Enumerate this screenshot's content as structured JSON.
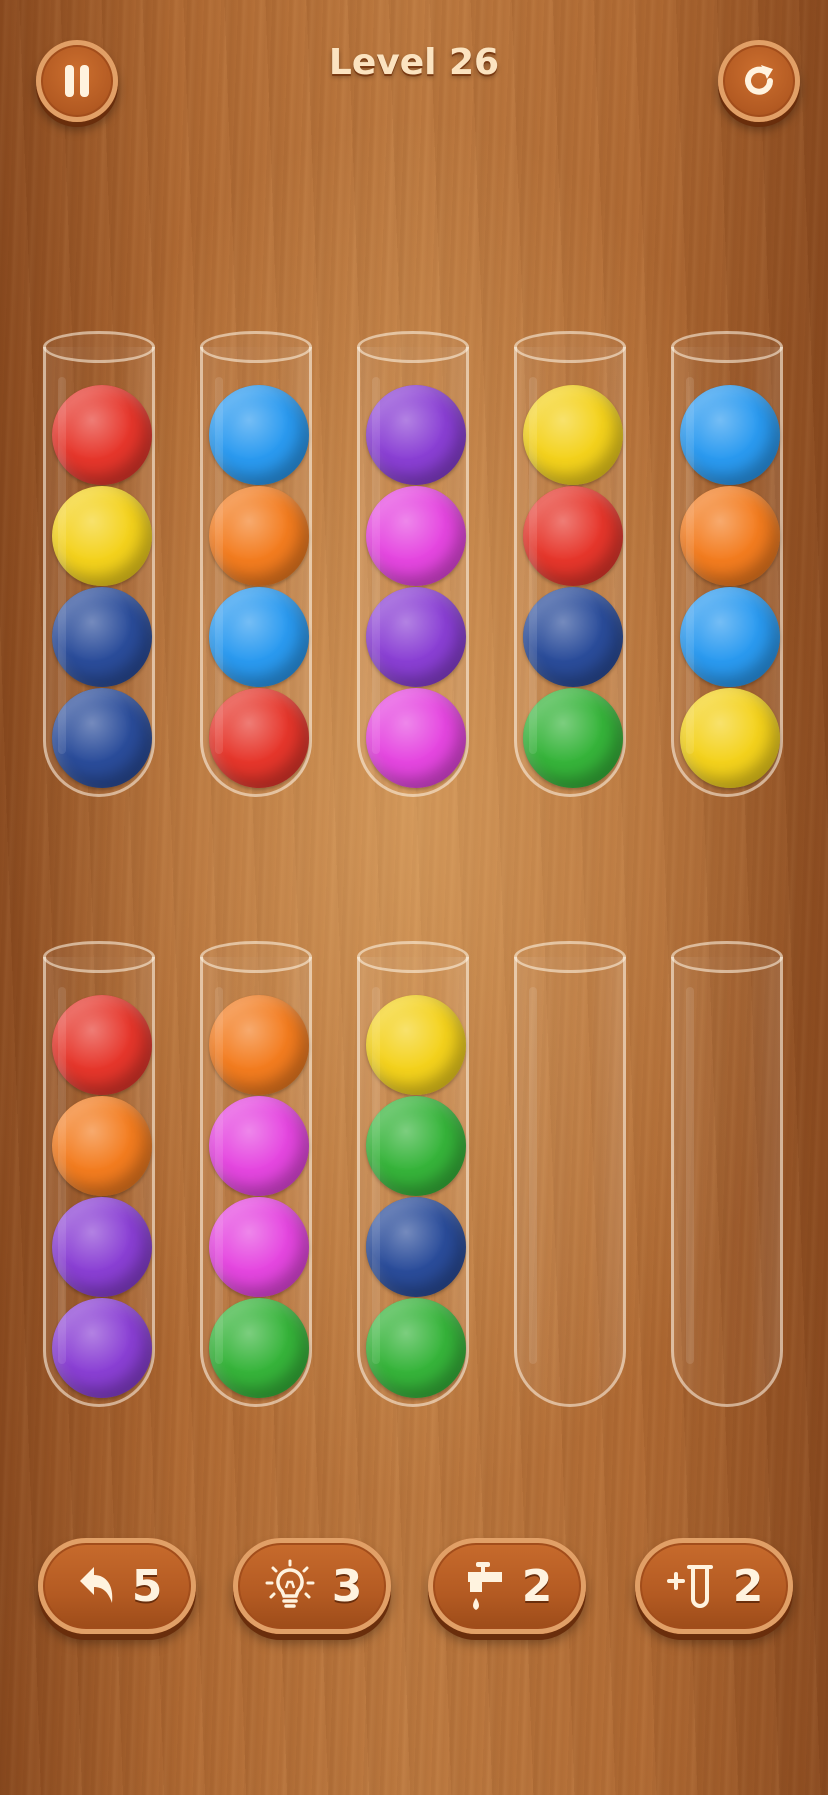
{
  "header": {
    "level_label": "Level 26",
    "pause_icon": "pause-icon",
    "restart_icon": "restart-icon"
  },
  "colors": {
    "red": "#e6362b",
    "yellow": "#f4d21c",
    "navy": "#2a4c9a",
    "blue": "#2a9af0",
    "orange": "#f37c1f",
    "purple": "#8a3fd4",
    "magenta": "#e546e0",
    "green": "#36b43a"
  },
  "tubes": [
    {
      "balls": [
        "red",
        "yellow",
        "navy",
        "navy"
      ]
    },
    {
      "balls": [
        "blue",
        "orange",
        "blue",
        "red"
      ]
    },
    {
      "balls": [
        "purple",
        "magenta",
        "purple",
        "magenta"
      ]
    },
    {
      "balls": [
        "yellow",
        "red",
        "navy",
        "green"
      ]
    },
    {
      "balls": [
        "blue",
        "orange",
        "blue",
        "yellow"
      ]
    },
    {
      "balls": [
        "red",
        "orange",
        "purple",
        "purple"
      ]
    },
    {
      "balls": [
        "orange",
        "magenta",
        "magenta",
        "green"
      ]
    },
    {
      "balls": [
        "yellow",
        "green",
        "navy",
        "green"
      ]
    },
    {
      "balls": []
    },
    {
      "balls": []
    }
  ],
  "tools": [
    {
      "name": "undo",
      "icon": "undo-icon",
      "count": "5"
    },
    {
      "name": "hint",
      "icon": "lightbulb-icon",
      "count": "3"
    },
    {
      "name": "pour",
      "icon": "faucet-icon",
      "count": "2"
    },
    {
      "name": "add-tube",
      "icon": "add-tube-icon",
      "count": "2"
    }
  ]
}
